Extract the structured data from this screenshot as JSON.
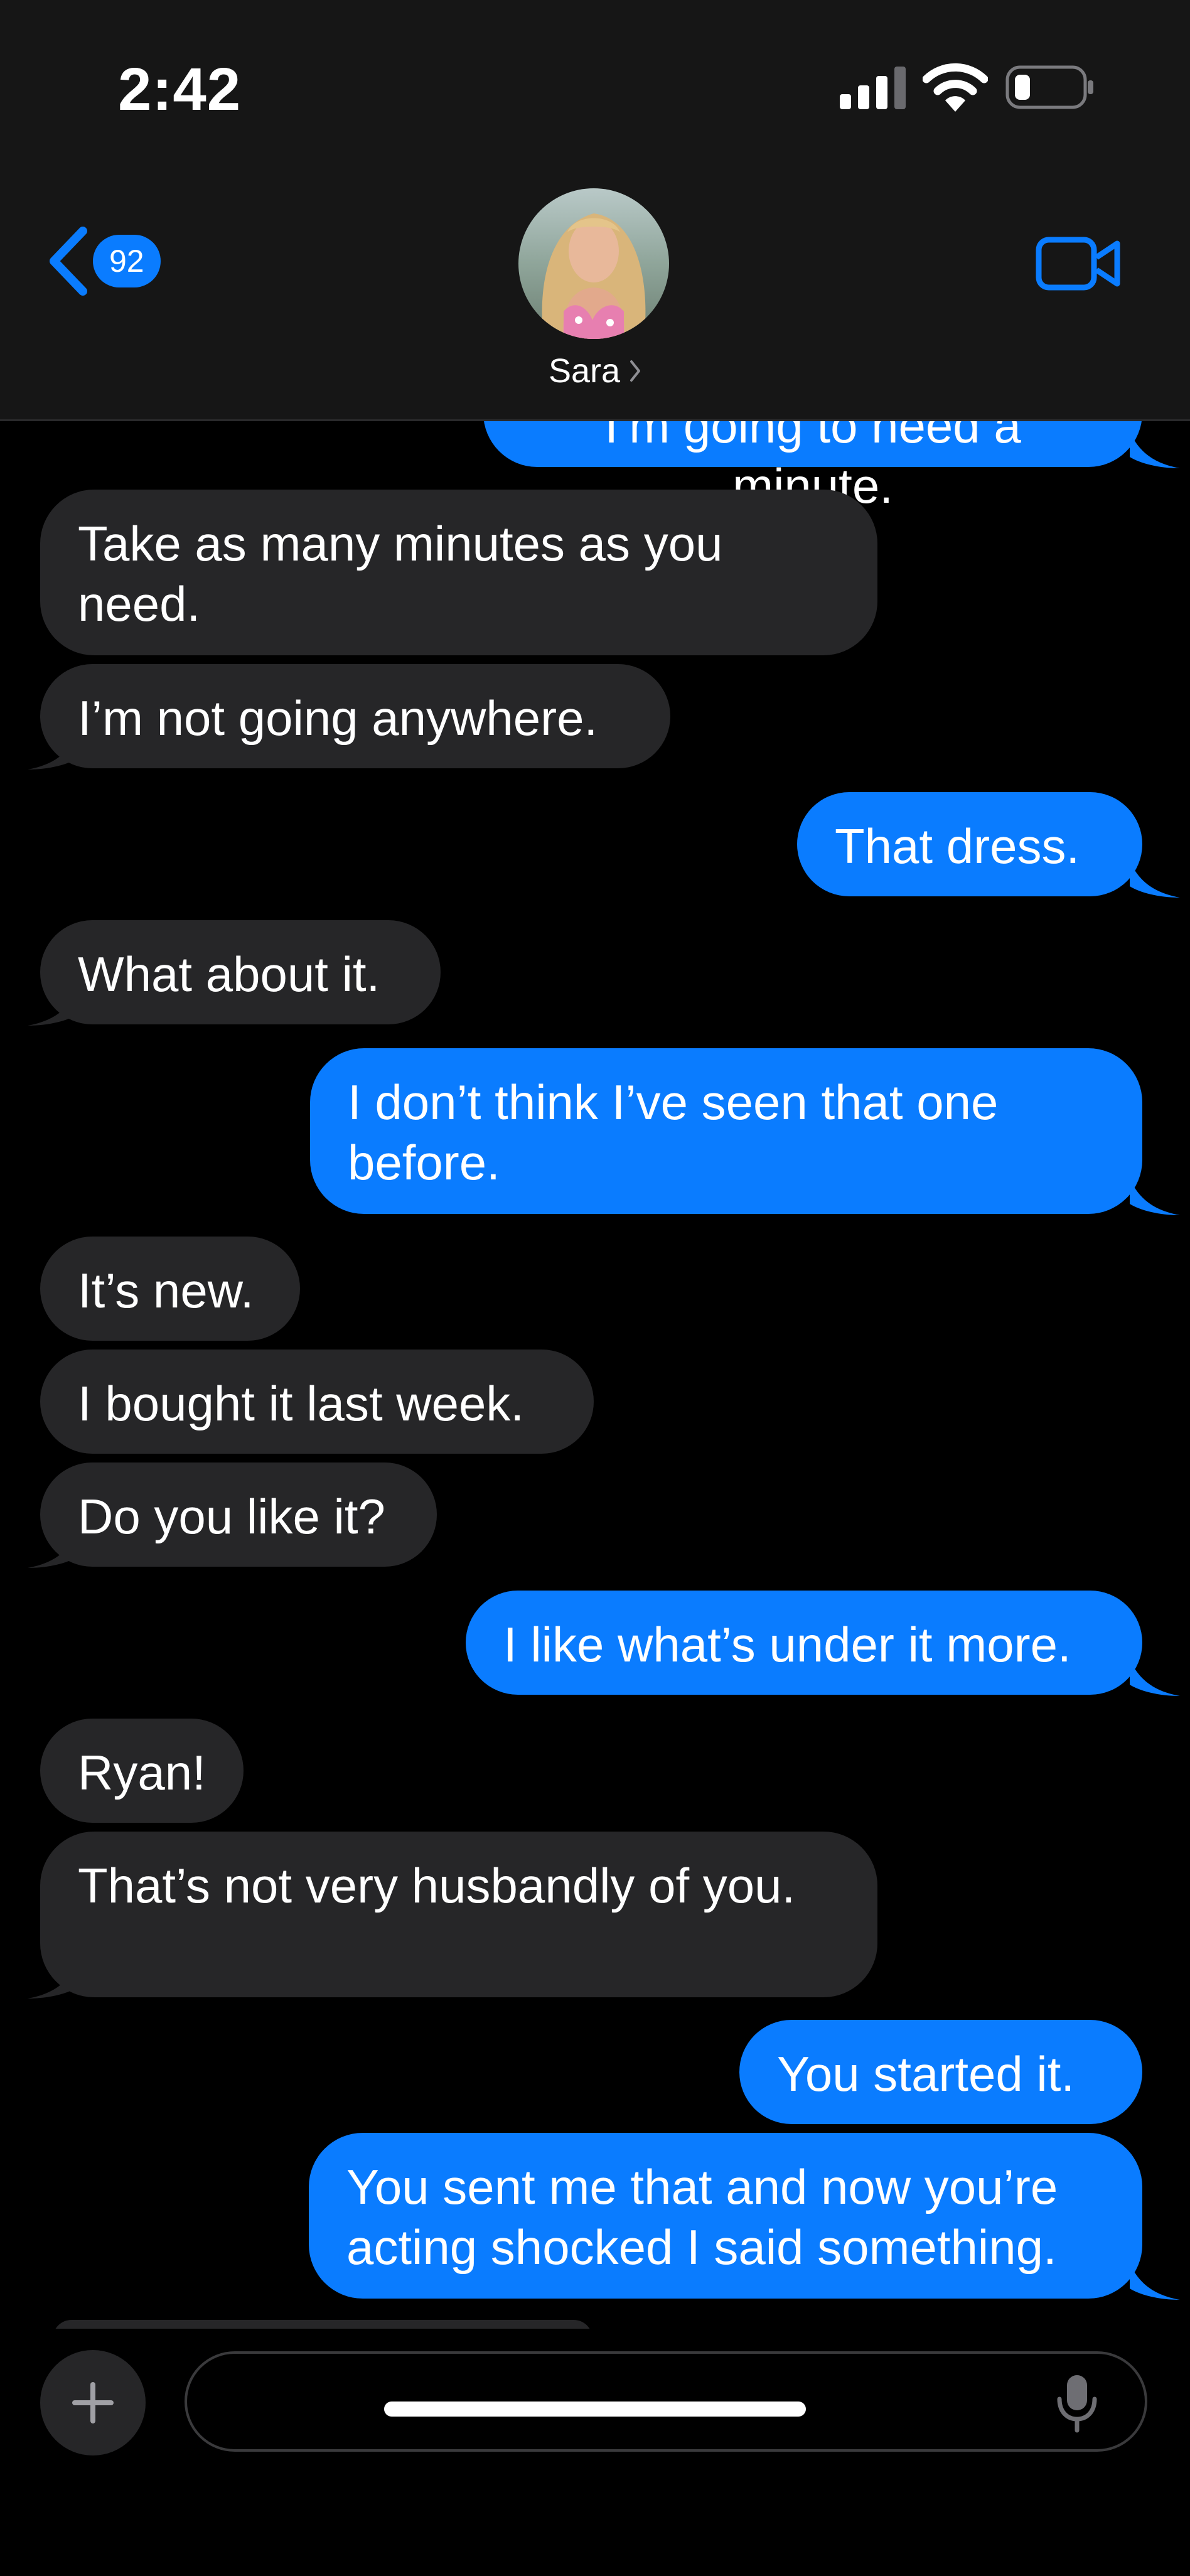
{
  "status_bar": {
    "time": "2:42"
  },
  "header": {
    "unread_count": "92",
    "contact_name": "Sara"
  },
  "messages": [
    {
      "from": "me",
      "text": "I’m going to need a minute."
    },
    {
      "from": "them",
      "text": "Take as many minutes as you need."
    },
    {
      "from": "them",
      "text": "I’m not going anywhere."
    },
    {
      "from": "me",
      "text": "That dress."
    },
    {
      "from": "them",
      "text": "What about it."
    },
    {
      "from": "me",
      "text": "I don’t think I’ve seen that one before."
    },
    {
      "from": "them",
      "text": "It’s new."
    },
    {
      "from": "them",
      "text": "I bought it last week."
    },
    {
      "from": "them",
      "text": "Do you like it?"
    },
    {
      "from": "me",
      "text": "I like what’s under it more."
    },
    {
      "from": "them",
      "text": "Ryan!"
    },
    {
      "from": "them",
      "text": "That’s not very husbandly of you."
    },
    {
      "from": "me",
      "text": "You started it."
    },
    {
      "from": "me",
      "text": "You sent me that and now you’re acting shocked I said something."
    }
  ],
  "composer": {
    "input_value": "",
    "input_placeholder": ""
  },
  "colors": {
    "outgoing_bubble": "#0a7cff",
    "incoming_bubble": "#262628",
    "accent": "#0a7cff",
    "background": "#000000"
  }
}
